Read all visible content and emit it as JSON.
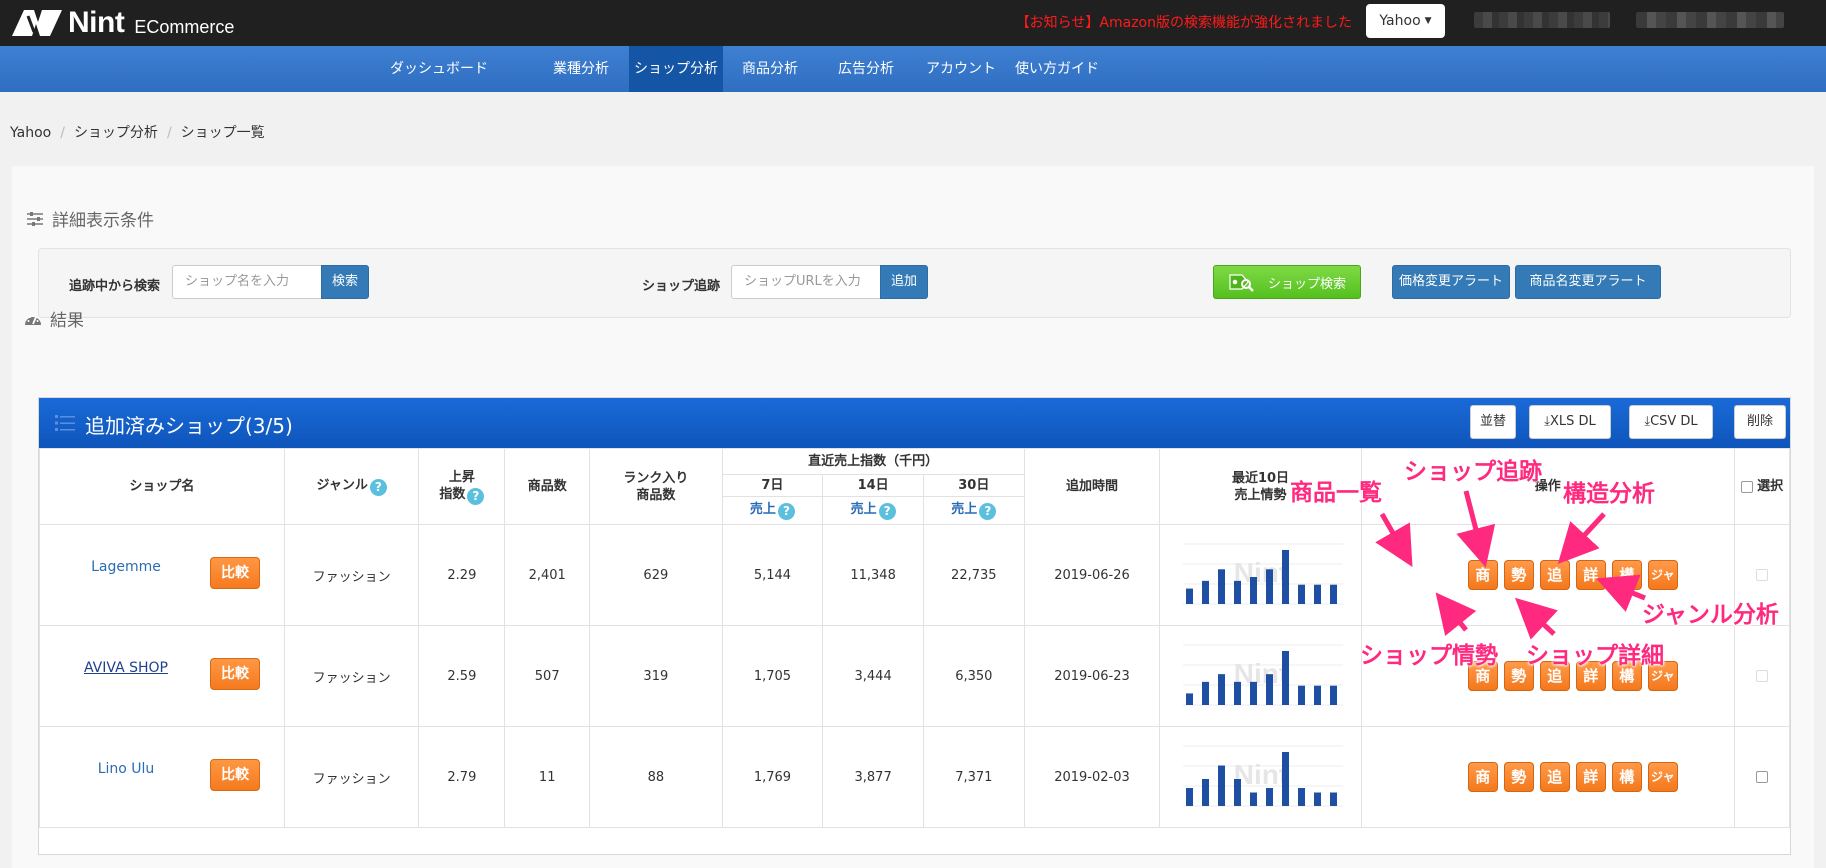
{
  "header": {
    "logo_text": "Nint",
    "logo_sub": "ECommerce",
    "notice": "【お知らせ】Amazon版の検索機能が強化されました",
    "market_select": "Yahoo"
  },
  "nav": [
    {
      "label": "ダッシュボード",
      "active": false
    },
    {
      "label": "業種分析",
      "active": false
    },
    {
      "label": "ショップ分析",
      "active": true
    },
    {
      "label": "商品分析",
      "active": false
    },
    {
      "label": "広告分析",
      "active": false
    },
    {
      "label": "アカウント",
      "active": false
    },
    {
      "label": "使い方ガイド",
      "active": false
    }
  ],
  "breadcrumb": [
    "Yahoo",
    "ショップ分析",
    "ショップ一覧"
  ],
  "filter": {
    "title": "詳細表示条件",
    "tracking_search_label": "追跡中から検索",
    "tracking_search_placeholder": "ショップ名を入力",
    "search_button": "検索",
    "shop_track_label": "ショップ追跡",
    "shop_track_placeholder": "ショップURLを入力",
    "add_button": "追加",
    "shop_search_button": "ショップ検索",
    "price_alert_button": "価格変更アラート",
    "name_alert_button": "商品名変更アラート"
  },
  "results": {
    "title": "結果",
    "panel_title": "追加済みショップ(3/5)",
    "buttons": {
      "sort": "並替",
      "xls": "XLS DL",
      "csv": "CSV DL",
      "delete": "削除"
    }
  },
  "table": {
    "headers": {
      "shop_name": "ショップ名",
      "genre": "ジャンル",
      "rise_1": "上昇",
      "rise_2": "指数",
      "items": "商品数",
      "ranked_1": "ランク入り",
      "ranked_2": "商品数",
      "recent_sales": "直近売上指数（千円）",
      "d7": "7日",
      "d14": "14日",
      "d30": "30日",
      "sales": "売上",
      "added": "追加時間",
      "trend_1": "最近10日",
      "trend_2": "売上情勢",
      "ops": "操作",
      "select": "選択",
      "help": "?"
    },
    "compare_label": "比較",
    "op_labels": [
      "商",
      "勢",
      "追",
      "詳",
      "構",
      "ジャ"
    ],
    "rows": [
      {
        "shop": "Lagemme",
        "genre": "ファッション",
        "rise": "2.29",
        "items": "2,401",
        "ranked": "629",
        "d7": "5,144",
        "d14": "11,348",
        "d30": "22,735",
        "added": "2019-06-26",
        "spark": [
          4,
          6,
          9,
          6,
          7,
          9,
          14,
          5,
          5,
          5
        ]
      },
      {
        "shop": "AVIVA SHOP",
        "genre": "ファッション",
        "rise": "2.59",
        "items": "507",
        "ranked": "319",
        "d7": "1,705",
        "d14": "3,444",
        "d30": "6,350",
        "added": "2019-06-23",
        "spark": [
          3,
          6,
          8,
          6,
          6,
          8,
          14,
          5,
          5,
          5
        ]
      },
      {
        "shop": "Lino Ulu",
        "genre": "ファッション",
        "rise": "2.79",
        "items": "11",
        "ranked": "88",
        "d7": "1,769",
        "d14": "3,877",
        "d30": "7,371",
        "added": "2019-02-03",
        "spark": [
          4,
          6,
          9,
          6,
          3,
          4,
          12,
          4,
          3,
          3
        ]
      }
    ]
  },
  "annotations": {
    "product_list": "商品一覧",
    "shop_tracking": "ショップ追跡",
    "structure": "構造分析",
    "genre": "ジャンル分析",
    "shop_trend": "ショップ情勢",
    "shop_detail": "ショップ詳細"
  },
  "colors": {
    "accent": "#337ab7",
    "orange": "#f57a1e",
    "annotation": "#ff2a7f",
    "notice": "#ff1a1a"
  }
}
